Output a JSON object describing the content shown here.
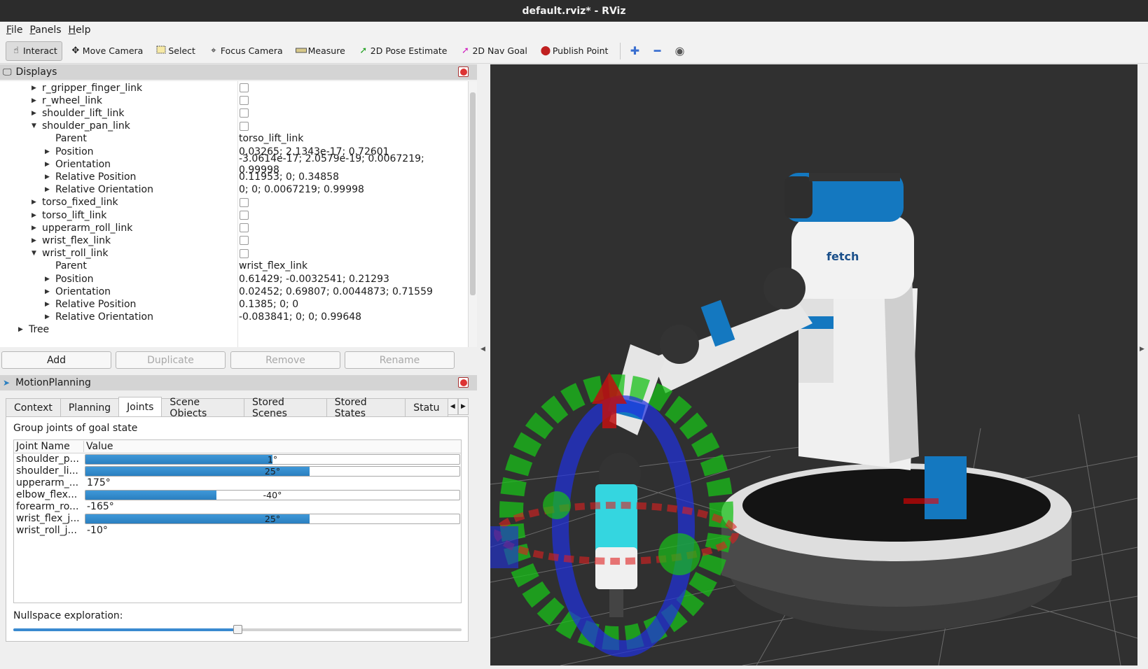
{
  "window": {
    "title": "default.rviz* - RViz"
  },
  "menu": [
    {
      "ul": "F",
      "rest": "ile"
    },
    {
      "ul": "P",
      "rest": "anels"
    },
    {
      "ul": "H",
      "rest": "elp"
    }
  ],
  "toolbar": {
    "interact": "Interact",
    "move_camera": "Move Camera",
    "select": "Select",
    "focus_camera": "Focus Camera",
    "measure": "Measure",
    "pose_estimate": "2D Pose Estimate",
    "nav_goal": "2D Nav Goal",
    "publish_point": "Publish Point"
  },
  "displays": {
    "title": "Displays",
    "rows": [
      {
        "name": "r_gripper_finger_link",
        "level": 1,
        "arrow": "right",
        "checkbox": true,
        "value": ""
      },
      {
        "name": "r_wheel_link",
        "level": 1,
        "arrow": "right",
        "checkbox": true,
        "value": ""
      },
      {
        "name": "shoulder_lift_link",
        "level": 1,
        "arrow": "right",
        "checkbox": true,
        "value": ""
      },
      {
        "name": "shoulder_pan_link",
        "level": 1,
        "arrow": "down",
        "checkbox": true,
        "value": ""
      },
      {
        "name": "Parent",
        "level": 2,
        "arrow": "none",
        "checkbox": false,
        "value": "torso_lift_link"
      },
      {
        "name": "Position",
        "level": 2,
        "arrow": "right",
        "checkbox": false,
        "value": "0.03265; 2.1343e-17; 0.72601"
      },
      {
        "name": "Orientation",
        "level": 2,
        "arrow": "right",
        "checkbox": false,
        "value": "-3.0614e-17; 2.0579e-19; 0.0067219; 0.99998"
      },
      {
        "name": "Relative Position",
        "level": 2,
        "arrow": "right",
        "checkbox": false,
        "value": "0.11953; 0; 0.34858"
      },
      {
        "name": "Relative Orientation",
        "level": 2,
        "arrow": "right",
        "checkbox": false,
        "value": "0; 0; 0.0067219; 0.99998"
      },
      {
        "name": "torso_fixed_link",
        "level": 1,
        "arrow": "right",
        "checkbox": true,
        "value": ""
      },
      {
        "name": "torso_lift_link",
        "level": 1,
        "arrow": "right",
        "checkbox": true,
        "value": ""
      },
      {
        "name": "upperarm_roll_link",
        "level": 1,
        "arrow": "right",
        "checkbox": true,
        "value": ""
      },
      {
        "name": "wrist_flex_link",
        "level": 1,
        "arrow": "right",
        "checkbox": true,
        "value": ""
      },
      {
        "name": "wrist_roll_link",
        "level": 1,
        "arrow": "down",
        "checkbox": true,
        "value": ""
      },
      {
        "name": "Parent",
        "level": 2,
        "arrow": "none",
        "checkbox": false,
        "value": "wrist_flex_link"
      },
      {
        "name": "Position",
        "level": 2,
        "arrow": "right",
        "checkbox": false,
        "value": "0.61429; -0.0032541; 0.21293"
      },
      {
        "name": "Orientation",
        "level": 2,
        "arrow": "right",
        "checkbox": false,
        "value": "0.02452; 0.69807; 0.0044873; 0.71559"
      },
      {
        "name": "Relative Position",
        "level": 2,
        "arrow": "right",
        "checkbox": false,
        "value": "0.1385; 0; 0"
      },
      {
        "name": "Relative Orientation",
        "level": 2,
        "arrow": "right",
        "checkbox": false,
        "value": "-0.083841; 0; 0; 0.99648"
      },
      {
        "name": "Tree",
        "level": 0,
        "arrow": "right",
        "checkbox": false,
        "value": ""
      }
    ],
    "buttons": {
      "add": "Add",
      "duplicate": "Duplicate",
      "remove": "Remove",
      "rename": "Rename"
    }
  },
  "motion_planning": {
    "title": "MotionPlanning",
    "tabs": [
      "Context",
      "Planning",
      "Joints",
      "Scene Objects",
      "Stored Scenes",
      "Stored States",
      "Statu"
    ],
    "active_tab": "Joints",
    "group_title": "Group joints of goal state",
    "columns": {
      "name": "Joint Name",
      "value": "Value"
    },
    "joints": [
      {
        "name": "shoulder_p...",
        "value": "1°",
        "type": "bar",
        "fraction": 0.5
      },
      {
        "name": "shoulder_li...",
        "value": "25°",
        "type": "bar",
        "fraction": 0.6
      },
      {
        "name": "upperarm_...",
        "value": "175°",
        "type": "text",
        "fraction": null
      },
      {
        "name": "elbow_flex...",
        "value": "-40°",
        "type": "bar",
        "fraction": 0.35
      },
      {
        "name": "forearm_ro...",
        "value": "-165°",
        "type": "text",
        "fraction": null
      },
      {
        "name": "wrist_flex_j...",
        "value": "25°",
        "type": "bar",
        "fraction": 0.6
      },
      {
        "name": "wrist_roll_j...",
        "value": "-10°",
        "type": "text",
        "fraction": null
      }
    ],
    "nullspace_label": "Nullspace exploration:",
    "nullspace_fraction": 0.5
  },
  "viewport": {
    "robot_logo": "fetch",
    "colors": {
      "background": "#303030",
      "grid": "#7a7a7a",
      "robot_blue": "#1478c0",
      "x_axis": "#e02020",
      "y_axis": "#20c020",
      "z_axis": "#2030e0"
    }
  }
}
